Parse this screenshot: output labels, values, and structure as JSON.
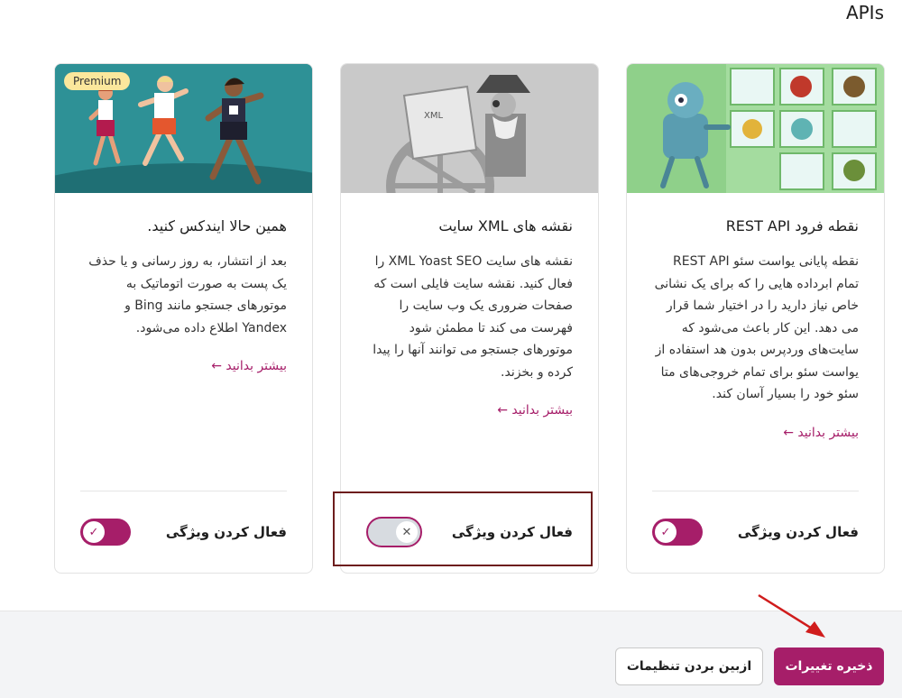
{
  "section_title": "APIs",
  "cards": [
    {
      "title": "نقطه فرود REST API",
      "description": "نقطه پایانی یواست سئو REST API تمام ابرداده هایی را که برای یک نشانی خاص نیاز دارید را در اختیار شما قرار می دهد. این کار باعث می‌شود که سایت‌های وردپرس بدون هد استفاده از یواست سئو برای تمام خروجی‌های متا سئو خود را بسیار آسان کند.",
      "link": "بیشتر بدانید ←",
      "toggle_label": "فعال کردن ویژگی",
      "toggle_state": "on",
      "image": "robot-illustration"
    },
    {
      "title": "نقشه های XML سایت",
      "description": "نقشه های سایت XML Yoast SEO را فعال کنید. نقشه سایت فایلی است که صفحات ضروری یک وب سایت را فهرست می کند تا مطمئن شود موتورهای جستجو می توانند آنها را پیدا کرده و بخزند.",
      "link": "بیشتر بدانید ←",
      "toggle_label": "فعال کردن ویژگی",
      "toggle_state": "off",
      "image": "pirate-map-illustration"
    },
    {
      "title": "همین حالا ایندکس کنید.",
      "description": "بعد از انتشار، به روز رسانی و یا حذف یک پست به صورت اتوماتیک به موتورهای جستجو مانند Bing و Yandex اطلاع داده می‌شود.",
      "link": "بیشتر بدانید ←",
      "toggle_label": "فعال کردن ویژگی",
      "toggle_state": "on",
      "badge": "Premium",
      "image": "runners-illustration"
    }
  ],
  "buttons": {
    "save": "ذخیره تغییرات",
    "reset": "ازبین بردن تنظیمات"
  },
  "icons": {
    "check": "✓",
    "cross": "✕"
  },
  "colors": {
    "brand": "#a61e69",
    "highlight": "#6d1d1d",
    "arrow": "#d01c1c"
  }
}
